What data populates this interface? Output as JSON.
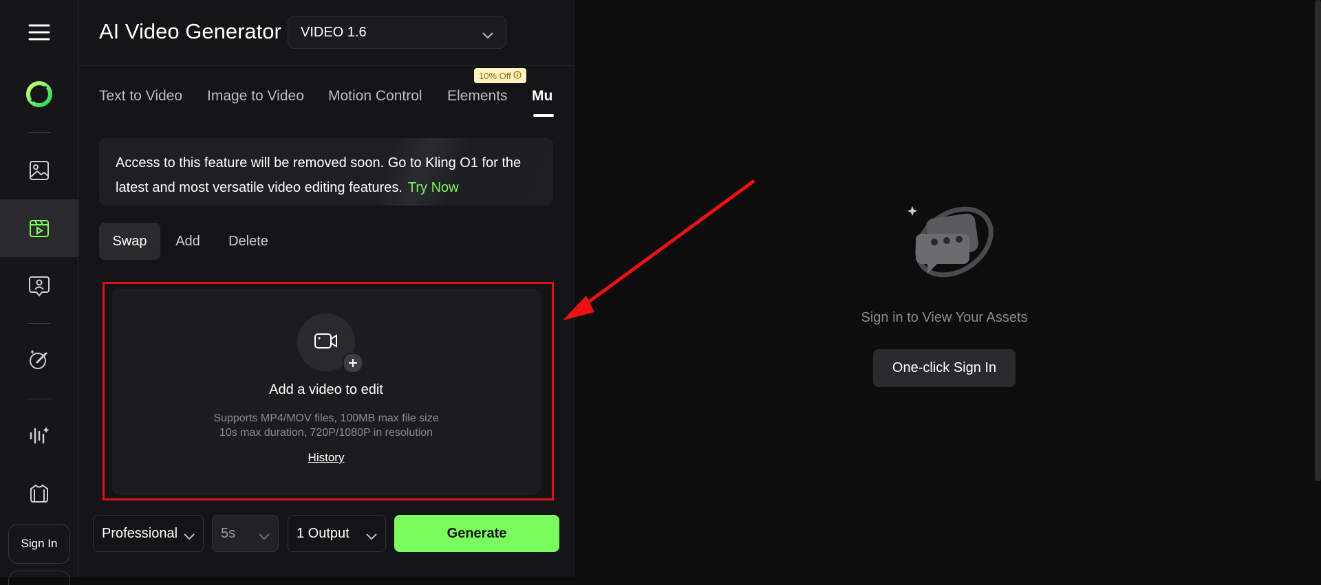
{
  "colors": {
    "accent": "#7bff5f",
    "link": "#7bf561",
    "highlight": "#e0101a",
    "badge_bg": "#fff3c4"
  },
  "rail": {
    "menu_icon": "hamburger-icon",
    "items": [
      "logo-icon",
      "image-icon",
      "video-icon",
      "avatar-icon",
      "brush-icon",
      "audio-icon",
      "tshirt-icon"
    ],
    "sign_in": "Sign In"
  },
  "header": {
    "title": "AI Video Generator",
    "model": "VIDEO 1.6"
  },
  "tabs": [
    {
      "label": "Text to Video"
    },
    {
      "label": "Image to Video"
    },
    {
      "label": "Motion Control"
    },
    {
      "label": "Elements"
    },
    {
      "label": "Mu",
      "active": true
    }
  ],
  "badge": {
    "text": "10% Off",
    "icon": "info-icon"
  },
  "notice": {
    "text": "Access to this feature will be removed soon. Go to Kling O1 for the latest and most versatile video editing features.",
    "link": "Try Now"
  },
  "modes": [
    {
      "label": "Swap",
      "active": true
    },
    {
      "label": "Add"
    },
    {
      "label": "Delete"
    }
  ],
  "upload": {
    "title": "Add a video to edit",
    "line1": "Supports MP4/MOV files, 100MB max file size",
    "line2": "10s max duration, 720P/1080P in resolution",
    "history": "History"
  },
  "footer": {
    "quality": "Professional",
    "duration": "5s",
    "outputs": "1 Output",
    "generate": "Generate"
  },
  "assets": {
    "message": "Sign in to View Your Assets",
    "sign_in_button": "One-click Sign In"
  }
}
